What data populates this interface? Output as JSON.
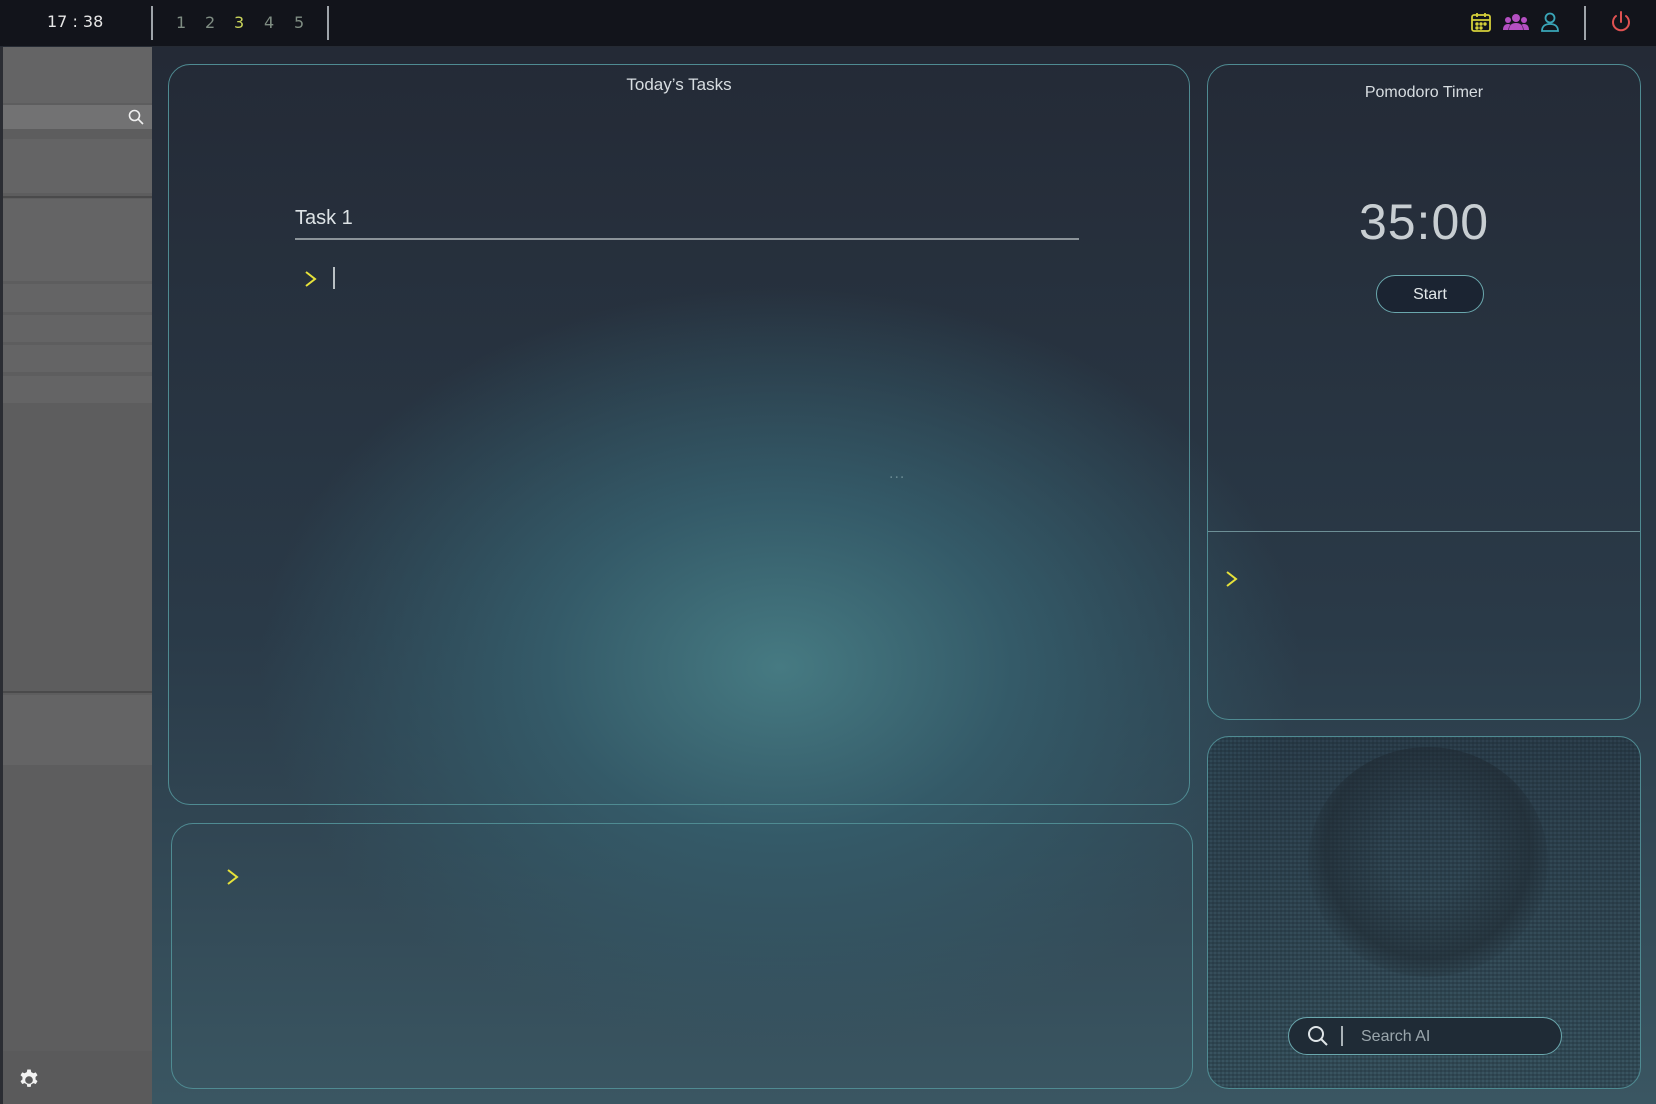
{
  "topbar": {
    "clock": "17 : 38",
    "workspaces": [
      "1",
      "2",
      "3",
      "4",
      "5"
    ],
    "active_workspace": "3",
    "icons": [
      "calendar-icon",
      "people-icon",
      "user-icon",
      "power-icon"
    ],
    "colors": {
      "active_workspace": "#c9d45a",
      "inactive_workspace": "#7f8d83",
      "calendar": "#d4cf3a",
      "people": "#b44fc2",
      "user": "#3aa6b8",
      "power": "#e05252"
    }
  },
  "sidebar": {
    "search_icon": "search-icon",
    "settings_icon": "gear-icon"
  },
  "tasks_panel": {
    "title": "Today’s Tasks",
    "task_title": "Task 1",
    "more_indicator": "..."
  },
  "pomodoro": {
    "title": "Pomodoro Timer",
    "time": "35:00",
    "start_label": "Start"
  },
  "ai_panel": {
    "search_placeholder": "Search AI"
  },
  "accent": {
    "prompt_arrow": "#e6e23a",
    "panel_border": "#4f8b92"
  }
}
